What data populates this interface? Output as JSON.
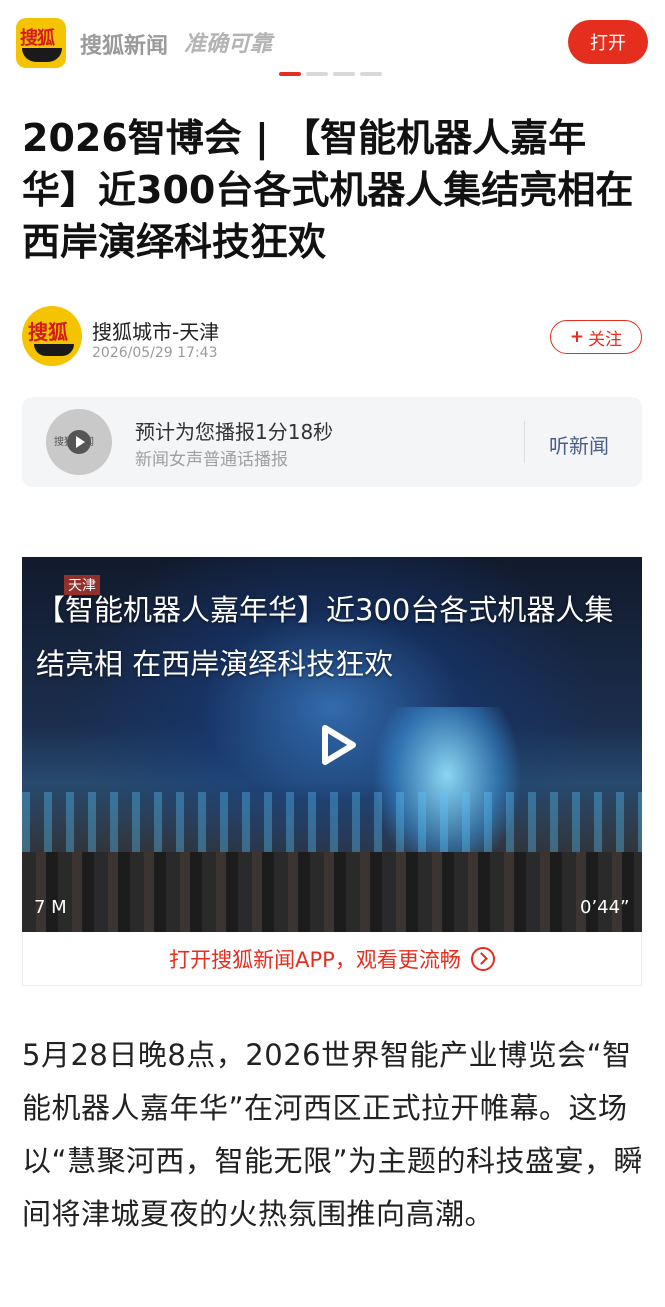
{
  "topbar": {
    "brand": "搜狐新闻",
    "slogan": "准确可靠",
    "open_label": "打开",
    "logo_text": "搜狐"
  },
  "article": {
    "title": "2026智博会 | 【智能机器人嘉年华】近300台各式机器人集结亮相在西岸演绎科技狂欢",
    "author": "搜狐城市-天津",
    "time": "2026/05/29 17:43",
    "follow_label": "关注",
    "follow_icon": "+"
  },
  "audio": {
    "title": "预计为您播报1分18秒",
    "subtitle": "新闻女声普通话播报",
    "listen_label": "听新闻",
    "disc_text": "搜狐新闻"
  },
  "video": {
    "tag": "天津",
    "title": "【智能机器人嘉年华】近300台各式机器人集结亮相 在西岸演绎科技狂欢",
    "size": "7 M",
    "duration": "0’44”",
    "open_app": "打开搜狐新闻APP，观看更流畅"
  },
  "body": {
    "paragraph": "5月28日晚8点，2026世界智能产业博览会“智能机器人嘉年华”在河西区正式拉开帷幕。这场以“慧聚河西，智能无限”为主题的科技盛宴，瞬间将津城夏夜的火热氛围推向高潮。"
  },
  "colors": {
    "accent": "#e62e1e",
    "brand_yellow": "#f5c400",
    "listen": "#4a5e8a"
  }
}
